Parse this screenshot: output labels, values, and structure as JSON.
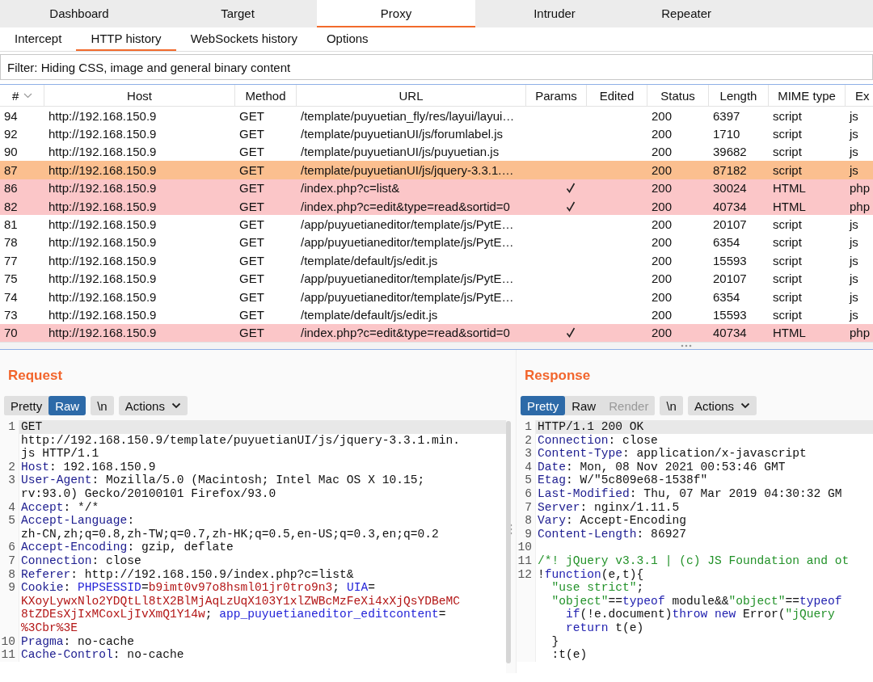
{
  "tabs": [
    {
      "label": "Dashboard",
      "selected": false
    },
    {
      "label": "Target",
      "selected": false
    },
    {
      "label": "Proxy",
      "selected": true
    },
    {
      "label": "Intruder",
      "selected": false
    },
    {
      "label": "Repeater",
      "selected": false
    }
  ],
  "subtabs": [
    {
      "label": "Intercept",
      "selected": false
    },
    {
      "label": "HTTP history",
      "selected": true
    },
    {
      "label": "WebSockets history",
      "selected": false
    },
    {
      "label": "Options",
      "selected": false
    }
  ],
  "filter": "Filter: Hiding CSS, image and general binary content",
  "table": {
    "columns": [
      "#",
      "Host",
      "Method",
      "URL",
      "Params",
      "Edited",
      "Status",
      "Length",
      "MIME type",
      "Ex"
    ],
    "rows": [
      {
        "num": "94",
        "host": "http://192.168.150.9",
        "method": "GET",
        "url": "/template/puyuetian_fly/res/layui/layui…",
        "params": false,
        "status": "200",
        "length": "6397",
        "mime": "script",
        "ext": "js"
      },
      {
        "num": "92",
        "host": "http://192.168.150.9",
        "method": "GET",
        "url": "/template/puyuetianUI/js/forumlabel.js",
        "params": false,
        "status": "200",
        "length": "1710",
        "mime": "script",
        "ext": "js"
      },
      {
        "num": "90",
        "host": "http://192.168.150.9",
        "method": "GET",
        "url": "/template/puyuetianUI/js/puyuetian.js",
        "params": false,
        "status": "200",
        "length": "39682",
        "mime": "script",
        "ext": "js"
      },
      {
        "num": "87",
        "host": "http://192.168.150.9",
        "method": "GET",
        "url": "/template/puyuetianUI/js/jquery-3.3.1.…",
        "params": false,
        "status": "200",
        "length": "87182",
        "mime": "script",
        "ext": "js",
        "color": "#fbbf8f"
      },
      {
        "num": "86",
        "host": "http://192.168.150.9",
        "method": "GET",
        "url": "/index.php?c=list&",
        "params": true,
        "status": "200",
        "length": "30024",
        "mime": "HTML",
        "ext": "php",
        "color": "#fbc6c8"
      },
      {
        "num": "82",
        "host": "http://192.168.150.9",
        "method": "GET",
        "url": "/index.php?c=edit&type=read&sortid=0",
        "params": true,
        "status": "200",
        "length": "40734",
        "mime": "HTML",
        "ext": "php",
        "color": "#fbc6c8"
      },
      {
        "num": "81",
        "host": "http://192.168.150.9",
        "method": "GET",
        "url": "/app/puyuetianeditor/template/js/PytE…",
        "params": false,
        "status": "200",
        "length": "20107",
        "mime": "script",
        "ext": "js"
      },
      {
        "num": "78",
        "host": "http://192.168.150.9",
        "method": "GET",
        "url": "/app/puyuetianeditor/template/js/PytE…",
        "params": false,
        "status": "200",
        "length": "6354",
        "mime": "script",
        "ext": "js"
      },
      {
        "num": "77",
        "host": "http://192.168.150.9",
        "method": "GET",
        "url": "/template/default/js/edit.js",
        "params": false,
        "status": "200",
        "length": "15593",
        "mime": "script",
        "ext": "js"
      },
      {
        "num": "75",
        "host": "http://192.168.150.9",
        "method": "GET",
        "url": "/app/puyuetianeditor/template/js/PytE…",
        "params": false,
        "status": "200",
        "length": "20107",
        "mime": "script",
        "ext": "js"
      },
      {
        "num": "74",
        "host": "http://192.168.150.9",
        "method": "GET",
        "url": "/app/puyuetianeditor/template/js/PytE…",
        "params": false,
        "status": "200",
        "length": "6354",
        "mime": "script",
        "ext": "js"
      },
      {
        "num": "73",
        "host": "http://192.168.150.9",
        "method": "GET",
        "url": "/template/default/js/edit.js",
        "params": false,
        "status": "200",
        "length": "15593",
        "mime": "script",
        "ext": "js"
      },
      {
        "num": "70",
        "host": "http://192.168.150.9",
        "method": "GET",
        "url": "/index.php?c=edit&type=read&sortid=0",
        "params": true,
        "status": "200",
        "length": "40734",
        "mime": "HTML",
        "ext": "php",
        "color": "#fbc6c8"
      }
    ]
  },
  "panels": [
    {
      "title": "Request",
      "views": [
        {
          "label": "Pretty",
          "selected": false,
          "disabled": false
        },
        {
          "label": "Raw",
          "selected": true,
          "disabled": false
        }
      ],
      "newline": "\\n",
      "actions": "Actions",
      "lines": [
        {
          "no": "1",
          "rows": [
            {
              "parts": [
                {
                  "kind": "plain",
                  "text": "GET"
                }
              ]
            },
            {
              "parts": [
                {
                  "kind": "plain",
                  "text": "http://192.168.150.9/template/puyuetianUI/js/jquery-3.3.1.min."
                }
              ]
            },
            {
              "parts": [
                {
                  "kind": "plain",
                  "text": "js HTTP/1.1"
                }
              ]
            }
          ]
        },
        {
          "no": "2",
          "rows": [
            {
              "parts": [
                {
                  "kind": "key",
                  "text": "Host"
                },
                {
                  "kind": "plain",
                  "text": ": 192.168.150.9"
                }
              ]
            }
          ]
        },
        {
          "no": "3",
          "rows": [
            {
              "parts": [
                {
                  "kind": "key",
                  "text": "User-Agent"
                },
                {
                  "kind": "plain",
                  "text": ": Mozilla/5.0 (Macintosh; Intel Mac OS X 10.15;"
                }
              ]
            },
            {
              "parts": [
                {
                  "kind": "plain",
                  "text": "rv:93.0) Gecko/20100101 Firefox/93.0"
                }
              ]
            }
          ]
        },
        {
          "no": "4",
          "rows": [
            {
              "parts": [
                {
                  "kind": "key",
                  "text": "Accept"
                },
                {
                  "kind": "plain",
                  "text": ": */*"
                }
              ]
            }
          ]
        },
        {
          "no": "5",
          "rows": [
            {
              "parts": [
                {
                  "kind": "key",
                  "text": "Accept-Language"
                },
                {
                  "kind": "plain",
                  "text": ":"
                }
              ]
            },
            {
              "parts": [
                {
                  "kind": "plain",
                  "text": "zh-CN,zh;q=0.8,zh-TW;q=0.7,zh-HK;q=0.5,en-US;q=0.3,en;q=0.2"
                }
              ]
            }
          ]
        },
        {
          "no": "6",
          "rows": [
            {
              "parts": [
                {
                  "kind": "key",
                  "text": "Accept-Encoding"
                },
                {
                  "kind": "plain",
                  "text": ": gzip, deflate"
                }
              ]
            }
          ]
        },
        {
          "no": "7",
          "rows": [
            {
              "parts": [
                {
                  "kind": "key",
                  "text": "Connection"
                },
                {
                  "kind": "plain",
                  "text": ": close"
                }
              ]
            }
          ]
        },
        {
          "no": "8",
          "rows": [
            {
              "parts": [
                {
                  "kind": "key",
                  "text": "Referer"
                },
                {
                  "kind": "plain",
                  "text": ": http://192.168.150.9/index.php?c=list&"
                }
              ]
            }
          ]
        },
        {
          "no": "9",
          "rows": [
            {
              "parts": [
                {
                  "kind": "key",
                  "text": "Cookie"
                },
                {
                  "kind": "plain",
                  "text": ": "
                },
                {
                  "kind": "name",
                  "text": "PHPSESSID"
                },
                {
                  "kind": "plain",
                  "text": "="
                },
                {
                  "kind": "value",
                  "text": "b9imt0v97o8hsml01jr0tro9n3"
                },
                {
                  "kind": "plain",
                  "text": "; "
                },
                {
                  "kind": "name",
                  "text": "UIA"
                },
                {
                  "kind": "plain",
                  "text": "="
                }
              ]
            },
            {
              "parts": [
                {
                  "kind": "value",
                  "text": "KXoyLywxNlo2YDQtLl8tX2BlMjAqLzUqX103Y1xlZWBcMzFeXi4xXjQsYDBeMC"
                }
              ]
            },
            {
              "parts": [
                {
                  "kind": "value",
                  "text": "8tZDEsXjIxMCoxLjIvXmQ1Y14w"
                },
                {
                  "kind": "plain",
                  "text": "; "
                },
                {
                  "kind": "name",
                  "text": "app_puyuetianeditor_editcontent"
                },
                {
                  "kind": "plain",
                  "text": "="
                }
              ]
            },
            {
              "parts": [
                {
                  "kind": "value",
                  "text": "%3Cbr%3E"
                }
              ]
            }
          ]
        },
        {
          "no": "10",
          "rows": [
            {
              "parts": [
                {
                  "kind": "key",
                  "text": "Pragma"
                },
                {
                  "kind": "plain",
                  "text": ": no-cache"
                }
              ]
            }
          ]
        },
        {
          "no": "11",
          "rows": [
            {
              "parts": [
                {
                  "kind": "key",
                  "text": "Cache-Control"
                },
                {
                  "kind": "plain",
                  "text": ": no-cache"
                }
              ]
            }
          ]
        }
      ]
    },
    {
      "title": "Response",
      "views": [
        {
          "label": "Pretty",
          "selected": true,
          "disabled": false
        },
        {
          "label": "Raw",
          "selected": false,
          "disabled": false
        },
        {
          "label": "Render",
          "selected": false,
          "disabled": true
        }
      ],
      "newline": "\\n",
      "actions": "Actions",
      "lines": [
        {
          "no": "1",
          "rows": [
            {
              "parts": [
                {
                  "kind": "plain",
                  "text": "HTTP/1.1 200 OK"
                }
              ]
            }
          ]
        },
        {
          "no": "2",
          "rows": [
            {
              "parts": [
                {
                  "kind": "key",
                  "text": "Connection"
                },
                {
                  "kind": "plain",
                  "text": ": close"
                }
              ]
            }
          ]
        },
        {
          "no": "3",
          "rows": [
            {
              "parts": [
                {
                  "kind": "key",
                  "text": "Content-Type"
                },
                {
                  "kind": "plain",
                  "text": ": application/x-javascript"
                }
              ]
            }
          ]
        },
        {
          "no": "4",
          "rows": [
            {
              "parts": [
                {
                  "kind": "key",
                  "text": "Date"
                },
                {
                  "kind": "plain",
                  "text": ": Mon, 08 Nov 2021 00:53:46 GMT"
                }
              ]
            }
          ]
        },
        {
          "no": "5",
          "rows": [
            {
              "parts": [
                {
                  "kind": "key",
                  "text": "Etag"
                },
                {
                  "kind": "plain",
                  "text": ": W/\"5c809e68-1538f\""
                }
              ]
            }
          ]
        },
        {
          "no": "6",
          "rows": [
            {
              "parts": [
                {
                  "kind": "key",
                  "text": "Last-Modified"
                },
                {
                  "kind": "plain",
                  "text": ": Thu, 07 Mar 2019 04:30:32 GM"
                }
              ]
            }
          ]
        },
        {
          "no": "7",
          "rows": [
            {
              "parts": [
                {
                  "kind": "key",
                  "text": "Server"
                },
                {
                  "kind": "plain",
                  "text": ": nginx/1.11.5"
                }
              ]
            }
          ]
        },
        {
          "no": "8",
          "rows": [
            {
              "parts": [
                {
                  "kind": "key",
                  "text": "Vary"
                },
                {
                  "kind": "plain",
                  "text": ": Accept-Encoding"
                }
              ]
            }
          ]
        },
        {
          "no": "9",
          "rows": [
            {
              "parts": [
                {
                  "kind": "key",
                  "text": "Content-Length"
                },
                {
                  "kind": "plain",
                  "text": ": 86927"
                }
              ]
            }
          ]
        },
        {
          "no": "10"
        },
        {
          "no": "11",
          "rows": [
            {
              "parts": [
                {
                  "kind": "comment",
                  "text": "/*! jQuery v3.3.1 | (c) JS Foundation and ot"
                }
              ]
            }
          ]
        },
        {
          "no": "12",
          "rows": [
            {
              "parts": [
                {
                  "kind": "plain",
                  "text": "!"
                },
                {
                  "kind": "keyword",
                  "text": "function"
                },
                {
                  "kind": "plain",
                  "text": "(e,t){"
                }
              ]
            },
            {
              "parts": [
                {
                  "kind": "string",
                  "text": "  \"use strict\""
                },
                {
                  "kind": "plain",
                  "text": ";"
                }
              ]
            },
            {
              "parts": [
                {
                  "kind": "string",
                  "text": "  \"object\""
                },
                {
                  "kind": "plain",
                  "text": "=="
                },
                {
                  "kind": "keyword",
                  "text": "typeof"
                },
                {
                  "kind": "plain",
                  "text": " module&&"
                },
                {
                  "kind": "string",
                  "text": "\"object\""
                },
                {
                  "kind": "plain",
                  "text": "=="
                },
                {
                  "kind": "keyword",
                  "text": "typeof"
                }
              ]
            },
            {
              "parts": [
                {
                  "kind": "keyword",
                  "text": "    if"
                },
                {
                  "kind": "plain",
                  "text": "(!e.document)"
                },
                {
                  "kind": "keyword",
                  "text": "throw new"
                },
                {
                  "kind": "plain",
                  "text": " Error("
                },
                {
                  "kind": "string",
                  "text": "\"jQuery"
                }
              ]
            },
            {
              "parts": [
                {
                  "kind": "keyword",
                  "text": "    return"
                },
                {
                  "kind": "plain",
                  "text": " t(e)"
                }
              ]
            },
            {
              "parts": [
                {
                  "kind": "plain",
                  "text": "  }"
                }
              ]
            },
            {
              "parts": [
                {
                  "kind": "plain",
                  "text": "  :t(e)"
                }
              ]
            }
          ]
        }
      ]
    }
  ]
}
